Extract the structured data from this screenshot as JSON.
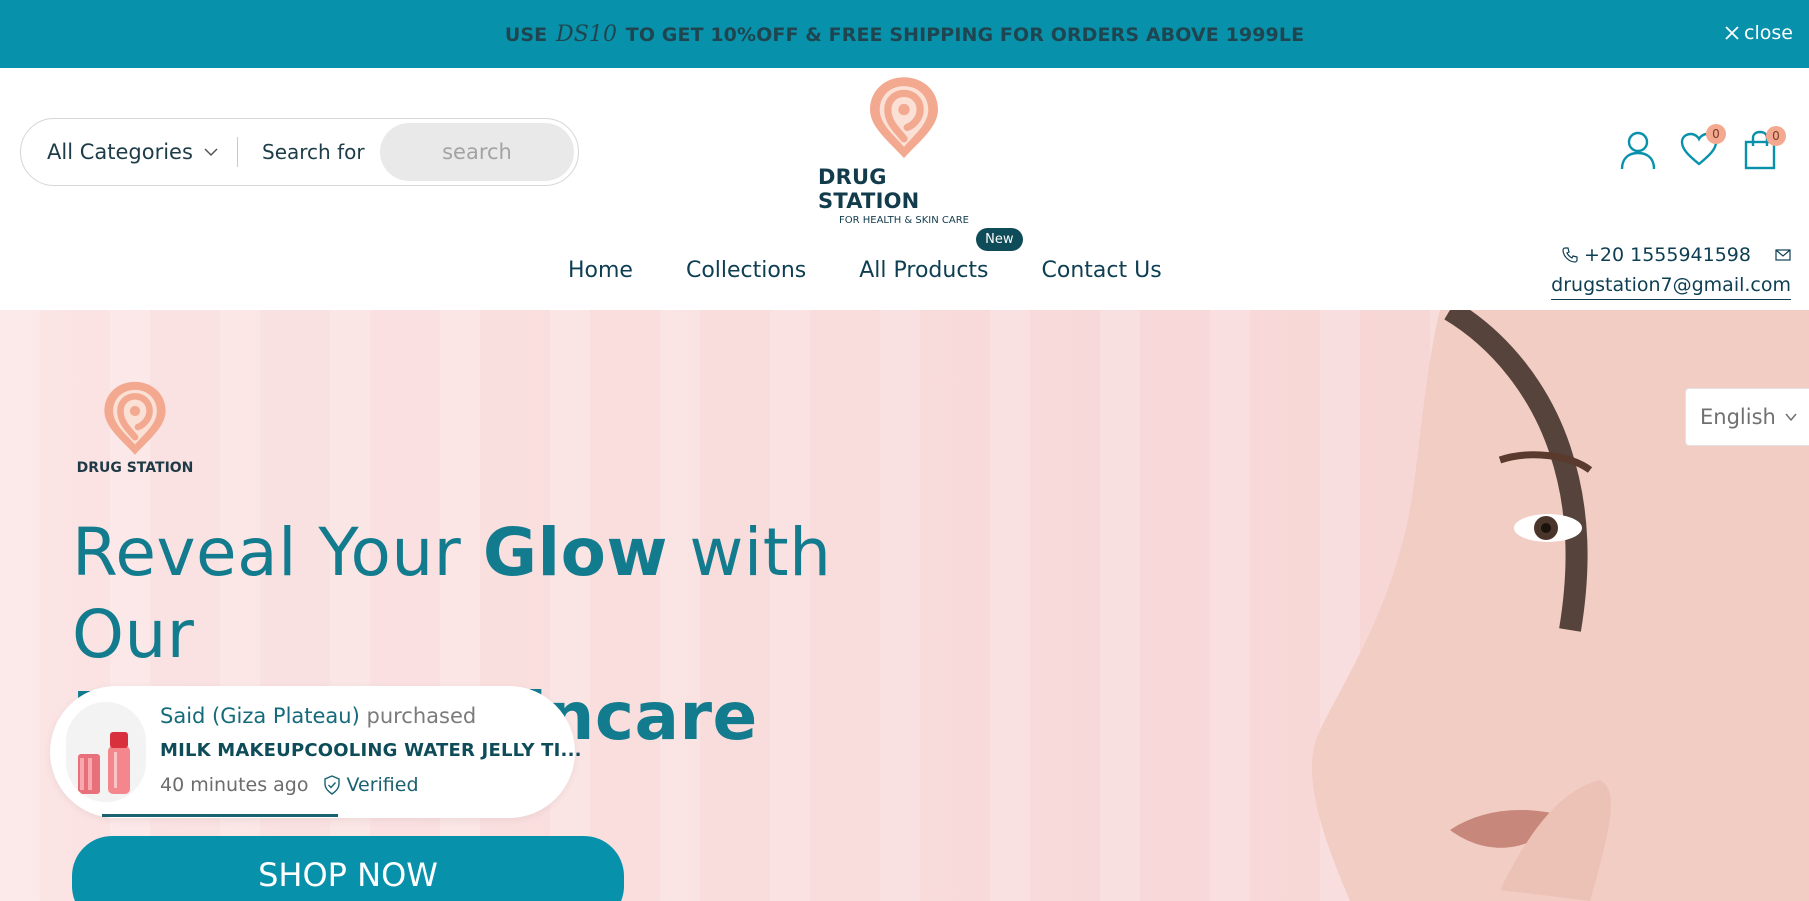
{
  "announcement": {
    "prefix": "USE",
    "code": "DS10",
    "suffix": "TO GET 10%OFF & FREE SHIPPING FOR ORDERS ABOVE 1999LE",
    "close_label": "close"
  },
  "header": {
    "category_select": "All Categories",
    "search_placeholder": "Search for",
    "search_button": "search",
    "logo_name": "DRUG STATION",
    "logo_tagline": "FOR HEALTH & SKIN CARE",
    "wishlist_count": "0",
    "cart_count": "0"
  },
  "nav": {
    "items": [
      {
        "label": "Home"
      },
      {
        "label": "Collections"
      },
      {
        "label": "All Products",
        "badge": "New"
      },
      {
        "label": "Contact Us"
      }
    ]
  },
  "contact": {
    "phone": "+20 1555941598",
    "email": "drugstation7@gmail.com"
  },
  "hero": {
    "logo_name": "DRUG STATION",
    "title_part1": "Reveal Your ",
    "title_bold1": "Glow",
    "title_part2": " with Our",
    "title_bold2": "Premium Skincare",
    "cta": "SHOP NOW"
  },
  "language": {
    "selected": "English"
  },
  "sales_popup": {
    "customer": "Said (Giza Plateau)",
    "action": "purchased",
    "product": "MILK MAKEUPCOOLING WATER JELLY TI...",
    "time": "40 minutes ago",
    "verified": "Verified",
    "progress_fraction": 0.45
  },
  "colors": {
    "brand_teal": "#0891ab",
    "dark_teal": "#0d4c58",
    "accent_peach": "#f3a98f",
    "hero_pink": "#f9dcdc"
  },
  "icons": [
    "close-icon",
    "chevron-down-icon",
    "user-icon",
    "heart-icon",
    "shopping-bag-icon",
    "phone-icon",
    "mail-icon",
    "shield-check-icon",
    "location-pin-logo"
  ]
}
